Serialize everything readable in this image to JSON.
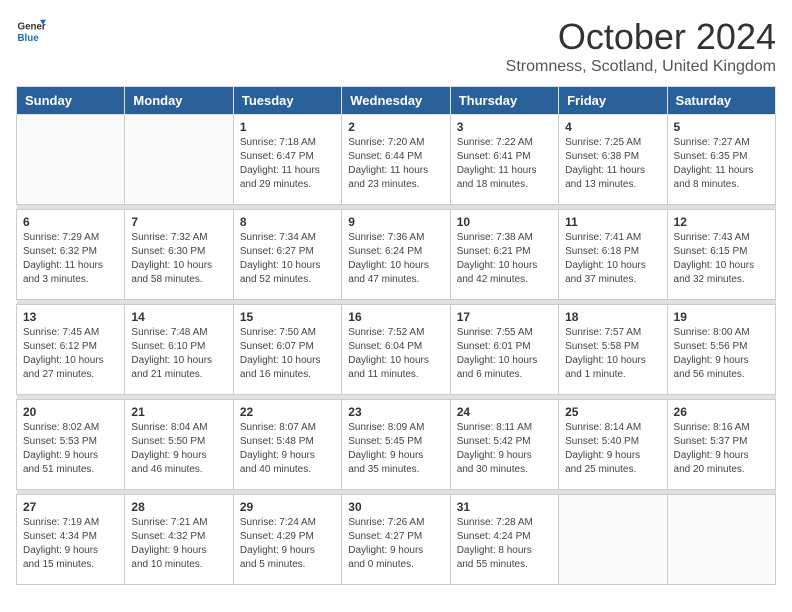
{
  "logo": {
    "general": "General",
    "blue": "Blue"
  },
  "title": "October 2024",
  "location": "Stromness, Scotland, United Kingdom",
  "headers": [
    "Sunday",
    "Monday",
    "Tuesday",
    "Wednesday",
    "Thursday",
    "Friday",
    "Saturday"
  ],
  "weeks": [
    [
      {
        "day": "",
        "text": ""
      },
      {
        "day": "",
        "text": ""
      },
      {
        "day": "1",
        "text": "Sunrise: 7:18 AM\nSunset: 6:47 PM\nDaylight: 11 hours\nand 29 minutes."
      },
      {
        "day": "2",
        "text": "Sunrise: 7:20 AM\nSunset: 6:44 PM\nDaylight: 11 hours\nand 23 minutes."
      },
      {
        "day": "3",
        "text": "Sunrise: 7:22 AM\nSunset: 6:41 PM\nDaylight: 11 hours\nand 18 minutes."
      },
      {
        "day": "4",
        "text": "Sunrise: 7:25 AM\nSunset: 6:38 PM\nDaylight: 11 hours\nand 13 minutes."
      },
      {
        "day": "5",
        "text": "Sunrise: 7:27 AM\nSunset: 6:35 PM\nDaylight: 11 hours\nand 8 minutes."
      }
    ],
    [
      {
        "day": "6",
        "text": "Sunrise: 7:29 AM\nSunset: 6:32 PM\nDaylight: 11 hours\nand 3 minutes."
      },
      {
        "day": "7",
        "text": "Sunrise: 7:32 AM\nSunset: 6:30 PM\nDaylight: 10 hours\nand 58 minutes."
      },
      {
        "day": "8",
        "text": "Sunrise: 7:34 AM\nSunset: 6:27 PM\nDaylight: 10 hours\nand 52 minutes."
      },
      {
        "day": "9",
        "text": "Sunrise: 7:36 AM\nSunset: 6:24 PM\nDaylight: 10 hours\nand 47 minutes."
      },
      {
        "day": "10",
        "text": "Sunrise: 7:38 AM\nSunset: 6:21 PM\nDaylight: 10 hours\nand 42 minutes."
      },
      {
        "day": "11",
        "text": "Sunrise: 7:41 AM\nSunset: 6:18 PM\nDaylight: 10 hours\nand 37 minutes."
      },
      {
        "day": "12",
        "text": "Sunrise: 7:43 AM\nSunset: 6:15 PM\nDaylight: 10 hours\nand 32 minutes."
      }
    ],
    [
      {
        "day": "13",
        "text": "Sunrise: 7:45 AM\nSunset: 6:12 PM\nDaylight: 10 hours\nand 27 minutes."
      },
      {
        "day": "14",
        "text": "Sunrise: 7:48 AM\nSunset: 6:10 PM\nDaylight: 10 hours\nand 21 minutes."
      },
      {
        "day": "15",
        "text": "Sunrise: 7:50 AM\nSunset: 6:07 PM\nDaylight: 10 hours\nand 16 minutes."
      },
      {
        "day": "16",
        "text": "Sunrise: 7:52 AM\nSunset: 6:04 PM\nDaylight: 10 hours\nand 11 minutes."
      },
      {
        "day": "17",
        "text": "Sunrise: 7:55 AM\nSunset: 6:01 PM\nDaylight: 10 hours\nand 6 minutes."
      },
      {
        "day": "18",
        "text": "Sunrise: 7:57 AM\nSunset: 5:58 PM\nDaylight: 10 hours\nand 1 minute."
      },
      {
        "day": "19",
        "text": "Sunrise: 8:00 AM\nSunset: 5:56 PM\nDaylight: 9 hours\nand 56 minutes."
      }
    ],
    [
      {
        "day": "20",
        "text": "Sunrise: 8:02 AM\nSunset: 5:53 PM\nDaylight: 9 hours\nand 51 minutes."
      },
      {
        "day": "21",
        "text": "Sunrise: 8:04 AM\nSunset: 5:50 PM\nDaylight: 9 hours\nand 46 minutes."
      },
      {
        "day": "22",
        "text": "Sunrise: 8:07 AM\nSunset: 5:48 PM\nDaylight: 9 hours\nand 40 minutes."
      },
      {
        "day": "23",
        "text": "Sunrise: 8:09 AM\nSunset: 5:45 PM\nDaylight: 9 hours\nand 35 minutes."
      },
      {
        "day": "24",
        "text": "Sunrise: 8:11 AM\nSunset: 5:42 PM\nDaylight: 9 hours\nand 30 minutes."
      },
      {
        "day": "25",
        "text": "Sunrise: 8:14 AM\nSunset: 5:40 PM\nDaylight: 9 hours\nand 25 minutes."
      },
      {
        "day": "26",
        "text": "Sunrise: 8:16 AM\nSunset: 5:37 PM\nDaylight: 9 hours\nand 20 minutes."
      }
    ],
    [
      {
        "day": "27",
        "text": "Sunrise: 7:19 AM\nSunset: 4:34 PM\nDaylight: 9 hours\nand 15 minutes."
      },
      {
        "day": "28",
        "text": "Sunrise: 7:21 AM\nSunset: 4:32 PM\nDaylight: 9 hours\nand 10 minutes."
      },
      {
        "day": "29",
        "text": "Sunrise: 7:24 AM\nSunset: 4:29 PM\nDaylight: 9 hours\nand 5 minutes."
      },
      {
        "day": "30",
        "text": "Sunrise: 7:26 AM\nSunset: 4:27 PM\nDaylight: 9 hours\nand 0 minutes."
      },
      {
        "day": "31",
        "text": "Sunrise: 7:28 AM\nSunset: 4:24 PM\nDaylight: 8 hours\nand 55 minutes."
      },
      {
        "day": "",
        "text": ""
      },
      {
        "day": "",
        "text": ""
      }
    ]
  ]
}
